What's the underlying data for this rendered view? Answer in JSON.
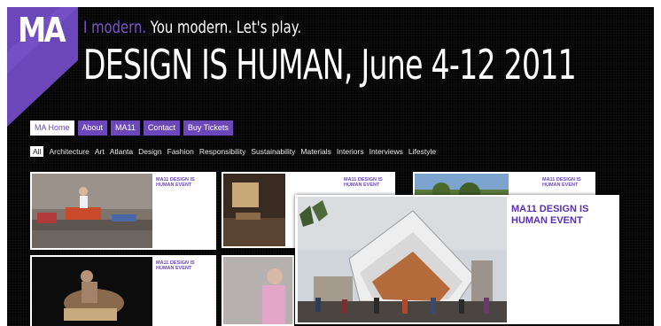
{
  "brand": {
    "logo_text": "MA",
    "accent": "#6b47b9"
  },
  "header": {
    "tagline_part1": "I modern.",
    "tagline_part2": "You modern. Let's play.",
    "headline": "DESIGN IS HUMAN, June 4-12 2011"
  },
  "topnav": [
    {
      "label": "MA Home",
      "active": true
    },
    {
      "label": "About"
    },
    {
      "label": "MA11"
    },
    {
      "label": "Contact"
    },
    {
      "label": "Buy Tickets"
    }
  ],
  "categories": [
    {
      "label": "All",
      "active": true
    },
    {
      "label": "Architecture"
    },
    {
      "label": "Art"
    },
    {
      "label": "Atlanta"
    },
    {
      "label": "Design"
    },
    {
      "label": "Fashion"
    },
    {
      "label": "Responsibility"
    },
    {
      "label": "Sustainability"
    },
    {
      "label": "Materials"
    },
    {
      "label": "Interiors"
    },
    {
      "label": "Interviews"
    },
    {
      "label": "Lifestyle"
    }
  ],
  "cards": [
    {
      "title": "MA11 DESIGN IS HUMAN EVENT"
    },
    {
      "title": "MA11 DESIGN IS HUMAN EVENT"
    },
    {
      "title": "MA11 DESIGN IS HUMAN EVENT"
    },
    {
      "title": "MA11 DESIGN IS HUMAN EVENT"
    }
  ],
  "feature": {
    "title": "MA11 DESIGN IS HUMAN EVENT"
  }
}
